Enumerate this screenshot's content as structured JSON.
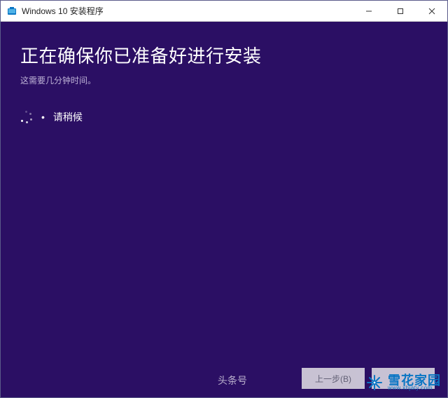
{
  "window": {
    "title": "Windows 10 安装程序"
  },
  "content": {
    "heading": "正在确保你已准备好进行安装",
    "subtext": "这需要几分钟时间。",
    "wait_bullet": "•",
    "wait_label": "请稍候"
  },
  "footer": {
    "back_label": "上一步(B)",
    "next_label": " "
  },
  "overlay": {
    "toutiao": "头条号",
    "brand": "雪花家园",
    "brand_sub": "www.xhjaty.com"
  },
  "colors": {
    "background": "#2b0f64",
    "brand_blue": "#0a76c4"
  }
}
